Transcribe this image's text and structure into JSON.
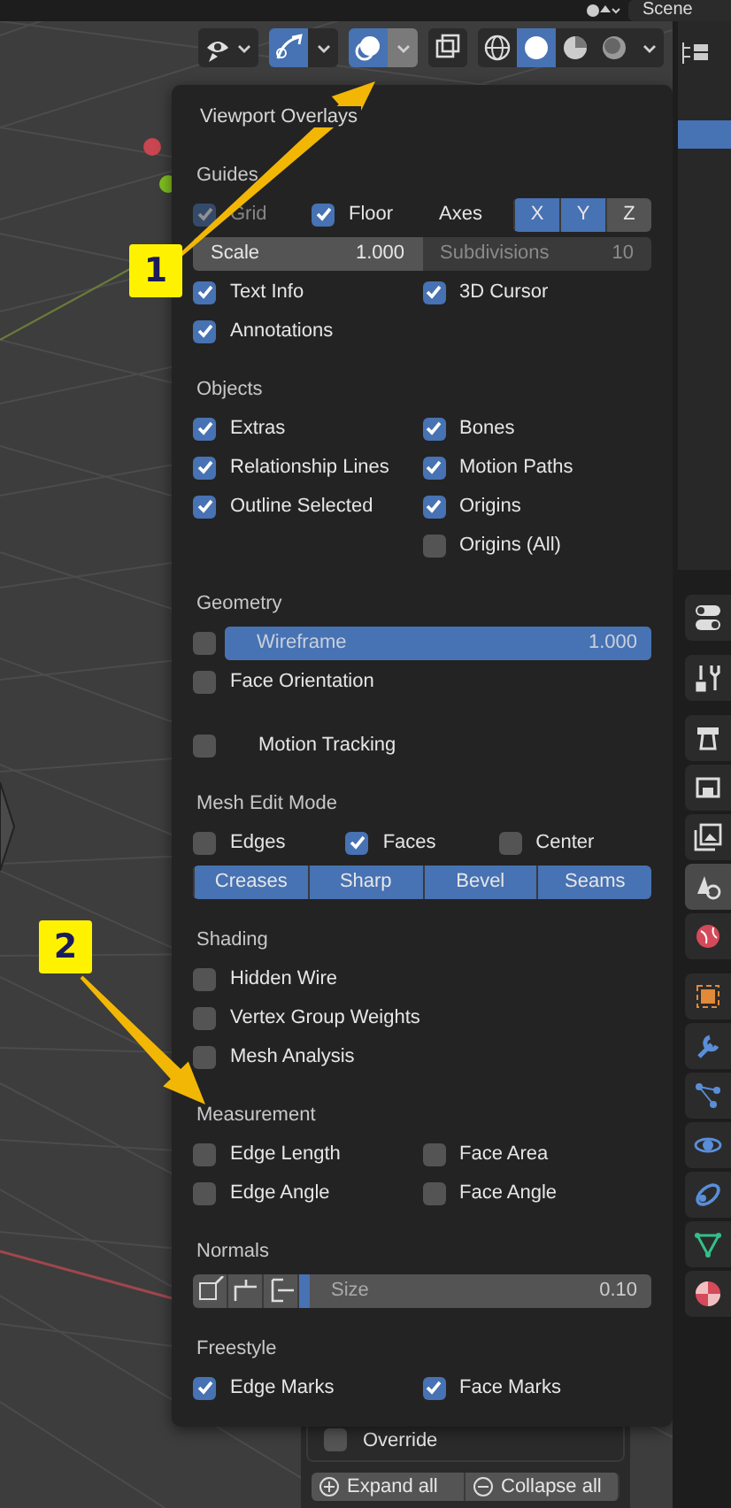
{
  "top_bar": {
    "scene_field": "Scene"
  },
  "header": {
    "tools": [
      {
        "kind": "visibility",
        "selected": false
      },
      {
        "kind": "gizmo",
        "selected": true
      },
      {
        "kind": "overlays",
        "selected": true,
        "expanded": true
      },
      {
        "kind": "xray",
        "selected": false
      }
    ],
    "shading": [
      {
        "kind": "wireframe",
        "selected": false
      },
      {
        "kind": "solid",
        "selected": true
      },
      {
        "kind": "material",
        "selected": false
      },
      {
        "kind": "rendered",
        "selected": false
      }
    ]
  },
  "popup": {
    "title": "Viewport Overlays",
    "sections": [
      {
        "heading": "Guides",
        "rows": [
          {
            "kind": "guides",
            "items": [
              {
                "label": "Grid",
                "checked": true,
                "disabled": true
              },
              {
                "label": "Floor",
                "checked": true,
                "disabled": false
              }
            ],
            "axes_label": "Axes",
            "axes": [
              {
                "label": "X",
                "selected": true
              },
              {
                "label": "Y",
                "selected": true
              },
              {
                "label": "Z",
                "selected": false
              }
            ]
          },
          {
            "kind": "fields",
            "fields": [
              {
                "label": "Scale",
                "value": "1.000",
                "disabled": false
              },
              {
                "label": "Subdivisions",
                "value": "10",
                "disabled": true
              }
            ]
          },
          {
            "kind": "check_pair",
            "items": [
              {
                "label": "Text Info",
                "checked": true
              },
              {
                "label": "3D Cursor",
                "checked": true
              }
            ]
          },
          {
            "kind": "check_pair",
            "items": [
              {
                "label": "Annotations",
                "checked": true
              }
            ]
          }
        ]
      },
      {
        "heading": "Objects",
        "rows": [
          {
            "kind": "check_pair",
            "items": [
              {
                "label": "Extras",
                "checked": true
              },
              {
                "label": "Bones",
                "checked": true
              }
            ]
          },
          {
            "kind": "check_pair",
            "items": [
              {
                "label": "Relationship Lines",
                "checked": true
              },
              {
                "label": "Motion Paths",
                "checked": true
              }
            ]
          },
          {
            "kind": "check_pair",
            "items": [
              {
                "label": "Outline Selected",
                "checked": true
              },
              {
                "label": "Origins",
                "checked": true
              }
            ]
          },
          {
            "kind": "check_right",
            "items": [
              {
                "label": "Origins (All)",
                "checked": false
              }
            ]
          }
        ]
      },
      {
        "heading": "Geometry",
        "rows": [
          {
            "kind": "slider_check",
            "checked": false,
            "label": "Wireframe",
            "value": "1.000",
            "level": 1
          },
          {
            "kind": "check_single",
            "items": [
              {
                "label": "Face Orientation",
                "checked": false
              }
            ]
          },
          {
            "kind": "panel_check",
            "label": "Motion Tracking",
            "checked": false
          }
        ]
      },
      {
        "heading": "Mesh Edit Mode",
        "rows": [
          {
            "kind": "check_triple",
            "items": [
              {
                "label": "Edges",
                "checked": false
              },
              {
                "label": "Faces",
                "checked": true
              },
              {
                "label": "Center",
                "checked": false
              }
            ]
          },
          {
            "kind": "toggles",
            "items": [
              {
                "label": "Creases",
                "selected": true
              },
              {
                "label": "Sharp",
                "selected": true
              },
              {
                "label": "Bevel",
                "selected": true
              },
              {
                "label": "Seams",
                "selected": true
              }
            ]
          }
        ]
      },
      {
        "heading": "Shading",
        "rows": [
          {
            "kind": "check_single",
            "items": [
              {
                "label": "Hidden Wire",
                "checked": false
              }
            ]
          },
          {
            "kind": "check_single",
            "items": [
              {
                "label": "Vertex Group Weights",
                "checked": false
              }
            ]
          },
          {
            "kind": "check_single",
            "items": [
              {
                "label": "Mesh Analysis",
                "checked": false
              }
            ]
          }
        ]
      },
      {
        "heading": "Measurement",
        "rows": [
          {
            "kind": "check_pair",
            "items": [
              {
                "label": "Edge Length",
                "checked": false
              },
              {
                "label": "Face Area",
                "checked": false
              }
            ]
          },
          {
            "kind": "check_pair",
            "items": [
              {
                "label": "Edge Angle",
                "checked": false
              },
              {
                "label": "Face Angle",
                "checked": false
              }
            ]
          }
        ]
      },
      {
        "heading": "Normals",
        "rows": [
          {
            "kind": "normals",
            "modes": [
              {
                "kind": "vertex",
                "selected": false
              },
              {
                "kind": "split",
                "selected": false
              },
              {
                "kind": "face",
                "selected": false
              }
            ],
            "label": "Size",
            "value": "0.10",
            "level": 0.03
          }
        ]
      },
      {
        "heading": "Freestyle",
        "rows": [
          {
            "kind": "check_pair",
            "items": [
              {
                "label": "Edge Marks",
                "checked": true
              },
              {
                "label": "Face Marks",
                "checked": true
              }
            ]
          }
        ]
      }
    ]
  },
  "bottom_panel": {
    "override": {
      "label": "Override",
      "checked": false
    },
    "buttons": [
      {
        "kind": "expand",
        "label": "Expand all"
      },
      {
        "kind": "collapse",
        "label": "Collapse all"
      }
    ]
  },
  "properties_tabs": [
    [
      {
        "kind": "tool_settings",
        "selected": false
      }
    ],
    [
      {
        "kind": "active_tool",
        "selected": false
      }
    ],
    [
      {
        "kind": "render",
        "selected": false
      },
      {
        "kind": "output",
        "selected": false
      },
      {
        "kind": "view_layer",
        "selected": false
      },
      {
        "kind": "scene",
        "selected": true
      },
      {
        "kind": "world",
        "selected": false
      }
    ],
    [
      {
        "kind": "object",
        "selected": false
      },
      {
        "kind": "modifiers",
        "selected": false
      },
      {
        "kind": "particles",
        "selected": false
      },
      {
        "kind": "physics",
        "selected": false
      },
      {
        "kind": "constraints",
        "selected": false
      },
      {
        "kind": "data",
        "selected": false
      },
      {
        "kind": "material",
        "selected": false
      }
    ]
  ],
  "callouts": [
    {
      "label": "1"
    },
    {
      "label": "2"
    }
  ]
}
